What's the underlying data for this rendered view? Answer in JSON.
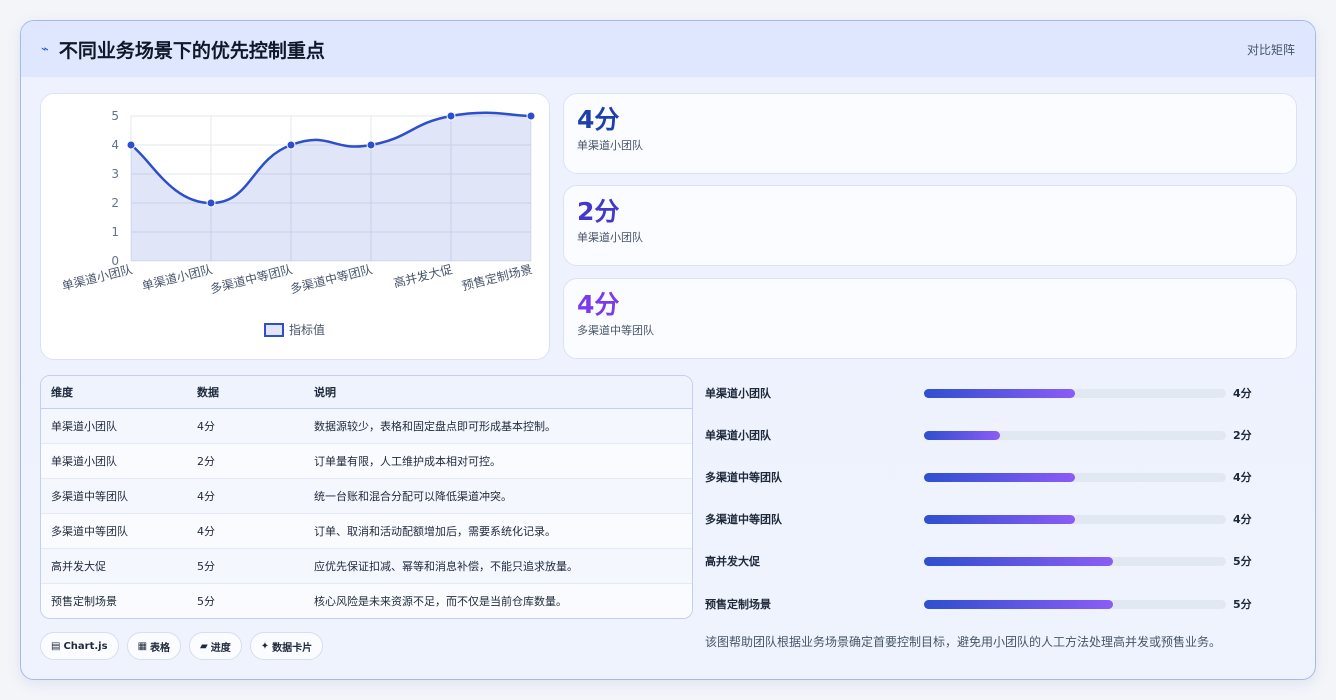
{
  "header": {
    "title": "不同业务场景下的优先控制重点",
    "badge": "对比矩阵",
    "icon": "lightning-icon"
  },
  "chart_data": {
    "type": "line",
    "categories": [
      "单渠道小团队",
      "单渠道小团队",
      "多渠道中等团队",
      "多渠道中等团队",
      "高并发大促",
      "预售定制场景"
    ],
    "series": [
      {
        "name": "指标值",
        "values": [
          4,
          2,
          4,
          4,
          5,
          5
        ]
      }
    ],
    "ylim": [
      0,
      5
    ],
    "yticks": [
      0,
      1,
      2,
      3,
      4,
      5
    ],
    "legend": "bottom",
    "grid": true,
    "color": "#2c4fcb"
  },
  "stats": [
    {
      "value": "4分",
      "label": "单渠道小团队",
      "color": "#1e40af"
    },
    {
      "value": "2分",
      "label": "单渠道小团队",
      "color": "#4338ca"
    },
    {
      "value": "4分",
      "label": "多渠道中等团队",
      "color": "#7c3aed"
    }
  ],
  "table": {
    "headers": [
      "维度",
      "数据",
      "说明"
    ],
    "rows": [
      [
        "单渠道小团队",
        "4分",
        "数据源较少，表格和固定盘点即可形成基本控制。"
      ],
      [
        "单渠道小团队",
        "2分",
        "订单量有限，人工维护成本相对可控。"
      ],
      [
        "多渠道中等团队",
        "4分",
        "统一台账和混合分配可以降低渠道冲突。"
      ],
      [
        "多渠道中等团队",
        "4分",
        "订单、取消和活动配额增加后，需要系统化记录。"
      ],
      [
        "高并发大促",
        "5分",
        "应优先保证扣减、幂等和消息补偿，不能只追求放量。"
      ],
      [
        "预售定制场景",
        "5分",
        "核心风险是未来资源不足，而不仅是当前仓库数量。"
      ]
    ]
  },
  "progress": [
    {
      "label": "单渠道小团队",
      "value": 4,
      "max": 8,
      "text": "4分"
    },
    {
      "label": "单渠道小团队",
      "value": 2,
      "max": 8,
      "text": "2分"
    },
    {
      "label": "多渠道中等团队",
      "value": 4,
      "max": 8,
      "text": "4分"
    },
    {
      "label": "多渠道中等团队",
      "value": 4,
      "max": 8,
      "text": "4分"
    },
    {
      "label": "高并发大促",
      "value": 5,
      "max": 8,
      "text": "5分"
    },
    {
      "label": "预售定制场景",
      "value": 5,
      "max": 8,
      "text": "5分"
    }
  ],
  "note": "该图帮助团队根据业务场景确定首要控制目标，避免用小团队的人工方法处理高并发或预售业务。",
  "chips": [
    {
      "icon": "▤",
      "label": "Chart.js"
    },
    {
      "icon": "▦",
      "label": "表格"
    },
    {
      "icon": "▰",
      "label": "进度"
    },
    {
      "icon": "✦",
      "label": "数据卡片"
    }
  ]
}
